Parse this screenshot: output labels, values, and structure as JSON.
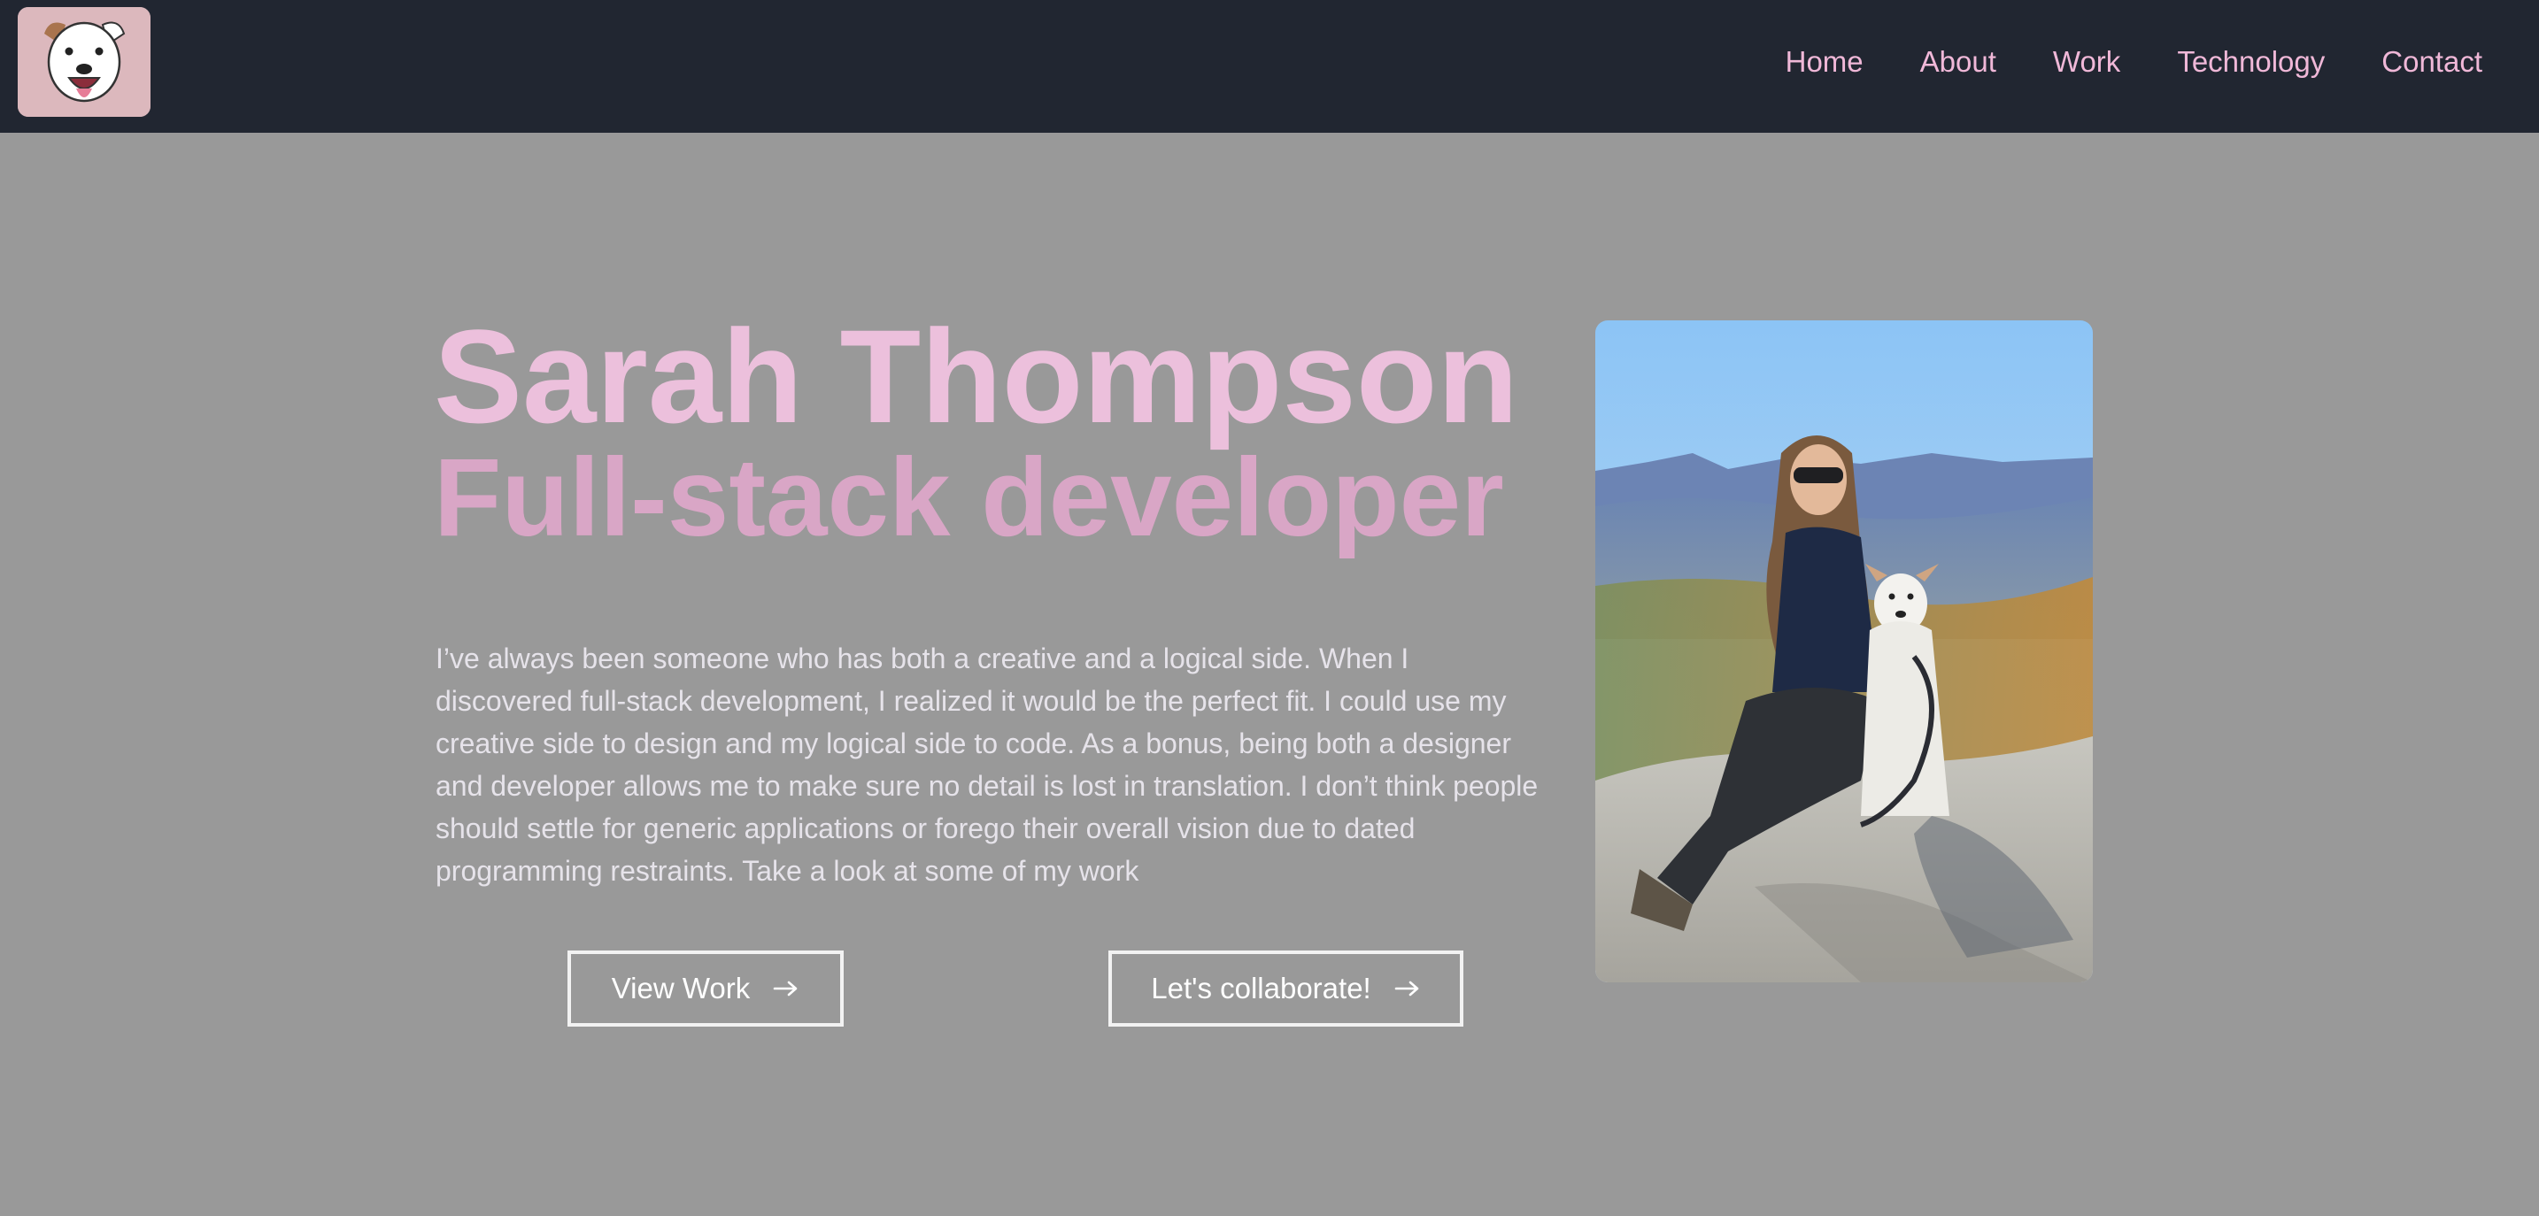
{
  "nav": {
    "logo_icon": "dog-face-icon",
    "links": [
      {
        "label": "Home"
      },
      {
        "label": "About"
      },
      {
        "label": "Work"
      },
      {
        "label": "Technology"
      },
      {
        "label": "Contact"
      }
    ]
  },
  "hero": {
    "name": "Sarah Thompson",
    "role": "Full-stack developer",
    "bio": "I’ve always been someone who has both a creative and a logical side. When I discovered full-stack development, I realized it would be the perfect fit. I could use my creative side to design and my logical side to code. As a bonus, being both a designer and developer allows me to make sure no detail is lost in translation. I don’t think people should settle for generic applications or forego their overall vision due to dated programming restraints. Take a look at some of my work",
    "buttons": {
      "view_work": "View Work",
      "collaborate": "Let's collaborate!",
      "arrow_icon": "arrow-right-icon"
    }
  },
  "colors": {
    "nav_bg": "#212631",
    "page_bg": "#999999",
    "nav_link": "#f0b8d8",
    "name": "#ecc0dc",
    "role": "#d9a6c6",
    "bio_text": "#e6e3ea"
  }
}
